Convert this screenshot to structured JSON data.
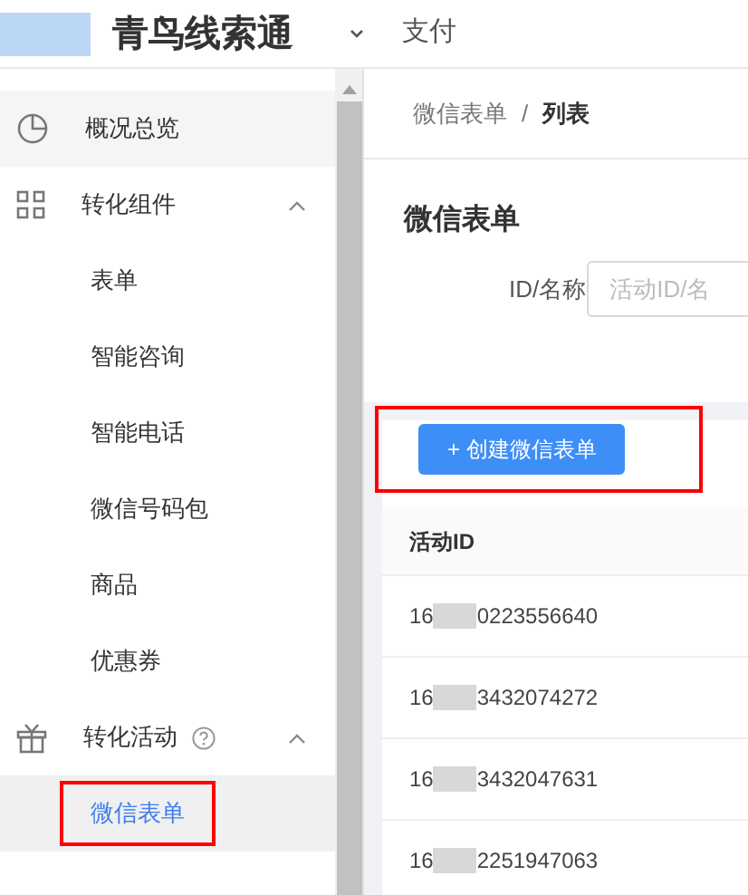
{
  "header": {
    "product": "青鸟线索通",
    "menu": "支付"
  },
  "sidebar": {
    "items": [
      {
        "label": "概况总览",
        "highlighted": true
      },
      {
        "label": "转化组件",
        "expanded": true,
        "children": [
          {
            "label": "表单",
            "selected": false,
            "annotated": false
          },
          {
            "label": "智能咨询",
            "selected": false,
            "annotated": false
          },
          {
            "label": "智能电话",
            "selected": false,
            "annotated": false
          },
          {
            "label": "微信号码包",
            "selected": false,
            "annotated": false
          },
          {
            "label": "商品",
            "selected": false,
            "annotated": false
          },
          {
            "label": "优惠券",
            "selected": false,
            "annotated": false
          }
        ]
      },
      {
        "label": "转化活动",
        "help": true,
        "expanded": true,
        "children": [
          {
            "label": "微信表单",
            "selected": true,
            "annotated": true
          }
        ]
      }
    ]
  },
  "breadcrumb": {
    "parent": "微信表单",
    "separator": "/",
    "current": "列表"
  },
  "page_title": "微信表单",
  "filter": {
    "label": "ID/名称",
    "placeholder": "活动ID/名"
  },
  "toolbar": {
    "button": "+ 创建微信表单",
    "annotated": true
  },
  "table": {
    "columns": [
      "活动ID"
    ],
    "rows": [
      {
        "prefix": "16",
        "suffix": "0223556640"
      },
      {
        "prefix": "16",
        "suffix": "3432074272"
      },
      {
        "prefix": "16",
        "suffix": "3432047631"
      },
      {
        "prefix": "16",
        "suffix": "2251947063"
      }
    ]
  }
}
